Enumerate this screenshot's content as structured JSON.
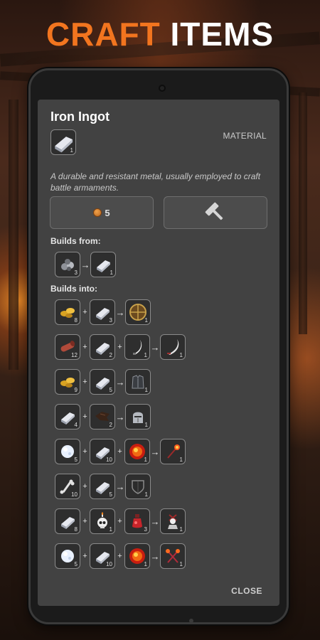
{
  "header": {
    "word1": "CRAFT",
    "word2": "ITEMS"
  },
  "item": {
    "title": "Iron Ingot",
    "category": "MATERIAL",
    "quantity": "1",
    "icon": "iron-ingot",
    "description": "A durable and resistant metal, usually employed to craft battle armaments."
  },
  "actions": {
    "price": "5",
    "price_icon": "coin-icon",
    "craft_icon": "hammer-icon"
  },
  "builds_from": {
    "label": "Builds from:",
    "recipe": {
      "inputs": [
        {
          "icon": "iron-ore",
          "qty": "3"
        }
      ],
      "outputs": [
        {
          "icon": "iron-ingot",
          "qty": "1"
        }
      ]
    }
  },
  "builds_into": {
    "label": "Builds into:",
    "recipes": [
      {
        "steps": [
          [
            {
              "icon": "gold-nuggets",
              "qty": "8"
            },
            {
              "icon": "iron-ingot",
              "qty": "3"
            }
          ],
          [
            {
              "icon": "round-shield",
              "qty": "1"
            }
          ]
        ]
      },
      {
        "steps": [
          [
            {
              "icon": "leather-roll",
              "qty": "12"
            },
            {
              "icon": "iron-ingot",
              "qty": "2"
            },
            {
              "icon": "blade",
              "qty": "1"
            }
          ],
          [
            {
              "icon": "scimitar",
              "qty": "1"
            }
          ]
        ]
      },
      {
        "steps": [
          [
            {
              "icon": "gold-nuggets",
              "qty": "9"
            },
            {
              "icon": "iron-ingot",
              "qty": "5"
            }
          ],
          [
            {
              "icon": "chest-armor",
              "qty": "1"
            }
          ]
        ]
      },
      {
        "steps": [
          [
            {
              "icon": "iron-ingot",
              "qty": "4"
            },
            {
              "icon": "leather-scrap",
              "qty": "2"
            }
          ],
          [
            {
              "icon": "knight-helmet",
              "qty": "1"
            }
          ]
        ]
      },
      {
        "steps": [
          [
            {
              "icon": "snowball",
              "qty": "5"
            },
            {
              "icon": "iron-ingot",
              "qty": "10"
            },
            {
              "icon": "fire-orb",
              "qty": "1"
            }
          ],
          [
            {
              "icon": "fire-staff",
              "qty": "1"
            }
          ]
        ]
      },
      {
        "steps": [
          [
            {
              "icon": "bone",
              "qty": "10"
            },
            {
              "icon": "iron-ingot",
              "qty": "5"
            }
          ],
          [
            {
              "icon": "dark-shield",
              "qty": "1"
            }
          ]
        ]
      },
      {
        "steps": [
          [
            {
              "icon": "iron-ingot",
              "qty": "8"
            },
            {
              "icon": "skull-candle",
              "qty": "1"
            },
            {
              "icon": "red-potion",
              "qty": "3"
            }
          ],
          [
            {
              "icon": "skull-totem",
              "qty": "1"
            }
          ]
        ]
      },
      {
        "steps": [
          [
            {
              "icon": "snowball",
              "qty": "5"
            },
            {
              "icon": "iron-ingot",
              "qty": "10"
            },
            {
              "icon": "fire-orb",
              "qty": "1"
            }
          ],
          [
            {
              "icon": "twin-scepters",
              "qty": "1"
            }
          ]
        ]
      }
    ]
  },
  "close_label": "CLOSE"
}
